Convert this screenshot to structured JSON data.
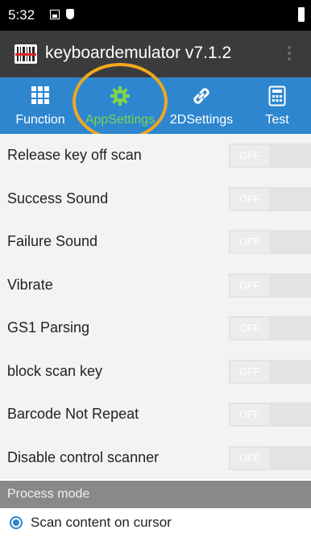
{
  "status_bar": {
    "time": "5:32"
  },
  "app_bar": {
    "title": "keyboardemulator v7.1.2"
  },
  "tabs": [
    {
      "label": "Function",
      "icon": "grid-icon"
    },
    {
      "label": "AppSettings",
      "icon": "gear-icon",
      "active": true
    },
    {
      "label": "2DSettings",
      "icon": "link-icon"
    },
    {
      "label": "Test",
      "icon": "calculator-icon"
    }
  ],
  "settings": [
    {
      "label": "Release key off scan",
      "state": "OFF"
    },
    {
      "label": "Success Sound",
      "state": "OFF"
    },
    {
      "label": "Failure Sound",
      "state": "OFF"
    },
    {
      "label": "Vibrate",
      "state": "OFF"
    },
    {
      "label": "GS1 Parsing",
      "state": "OFF"
    },
    {
      "label": "block scan key",
      "state": "OFF"
    },
    {
      "label": "Barcode Not Repeat",
      "state": "OFF"
    },
    {
      "label": "Disable control scanner",
      "state": "OFF"
    }
  ],
  "process_mode": {
    "header": "Process mode",
    "option": "Scan content on cursor"
  },
  "colors": {
    "tab_bar": "#2e86cf",
    "active_tab": "#7dd34a",
    "highlight": "#f0a820"
  }
}
